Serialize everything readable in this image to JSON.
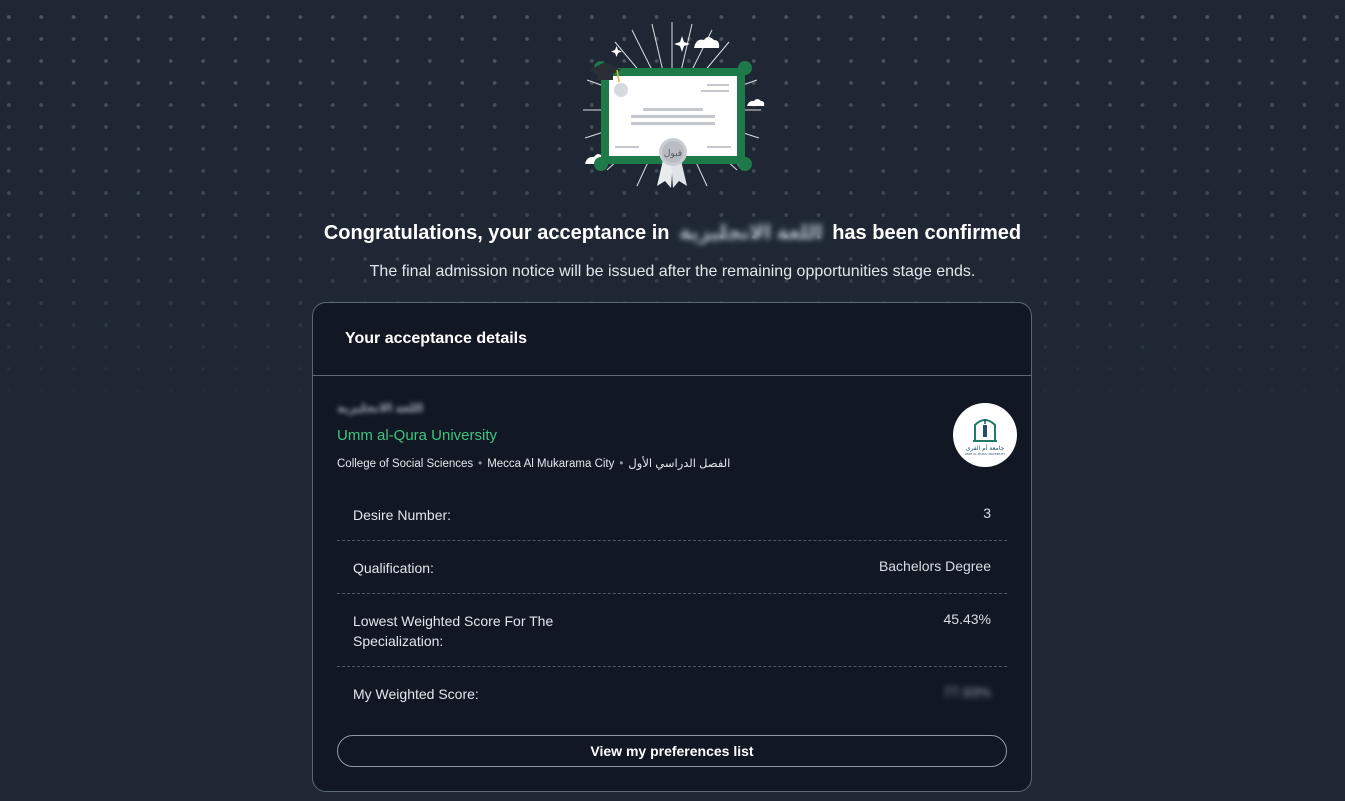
{
  "hero": {
    "title_before": "Congratulations, your acceptance in",
    "title_blurred": "اللغة الانجليزية",
    "title_after": "has been confirmed",
    "subtitle": "The final admission notice will be issued after the remaining opportunities stage ends.",
    "certificate_seal": "قبول"
  },
  "card": {
    "title": "Your acceptance details",
    "major_blurred": "اللغة الانجليزية",
    "university": "Umm al-Qura University",
    "meta": [
      "College of Social Sciences",
      "Mecca Al Mukarama City",
      "الفصل الدراسي الأول"
    ],
    "logo_text": "جامعة أم القرى",
    "logo_sub": "UMM AL-QURA UNIVERSITY",
    "rows": [
      {
        "label": "Desire Number:",
        "value": "3"
      },
      {
        "label": "Qualification:",
        "value": "Bachelors Degree"
      },
      {
        "label": "Lowest Weighted Score For The Specialization:",
        "value": "45.43%"
      },
      {
        "label": "My Weighted Score:",
        "value": "77.93%"
      }
    ],
    "button_label": "View my preferences list"
  },
  "colors": {
    "background": "#1e2733",
    "card": "#111823",
    "accent_green": "#3fc37f",
    "certificate_border": "#1f7a4a"
  }
}
